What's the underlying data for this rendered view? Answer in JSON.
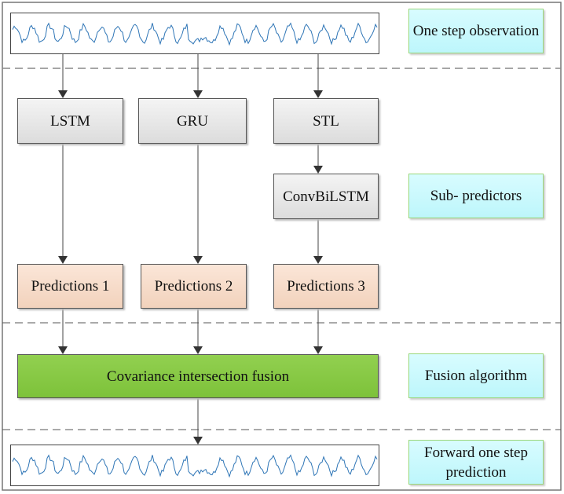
{
  "stages": {
    "observation_label": "One step observation",
    "subpredictors_label": "Sub- predictors",
    "fusion_label": "Fusion algorithm",
    "prediction_label": "Forward one step prediction"
  },
  "models": {
    "lstm": "LSTM",
    "gru": "GRU",
    "stl": "STL",
    "convbilstm": "ConvBiLSTM"
  },
  "predictions": [
    "Predictions 1",
    "Predictions 2",
    "Predictions 3"
  ],
  "fusion": {
    "title": "Covariance intersection fusion"
  },
  "colors": {
    "wave": "#2e75b6",
    "model_box": "#e6e6e6",
    "prediction_box": "#f8dccb",
    "fusion_box": "#8ac847",
    "stage_label": "#ccfafd"
  }
}
